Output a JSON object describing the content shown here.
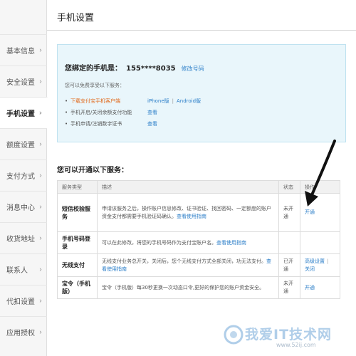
{
  "sidebar": {
    "items": [
      {
        "label": "基本信息",
        "active": false
      },
      {
        "label": "安全设置",
        "active": false
      },
      {
        "label": "手机设置",
        "active": true
      },
      {
        "label": "额度设置",
        "active": false
      },
      {
        "label": "支付方式",
        "active": false
      },
      {
        "label": "消息中心",
        "active": false
      },
      {
        "label": "收货地址",
        "active": false
      },
      {
        "label": "联系人",
        "active": false
      },
      {
        "label": "代扣设置",
        "active": false
      },
      {
        "label": "应用授权",
        "active": false
      }
    ],
    "chevron": "›"
  },
  "page": {
    "title": "手机设置"
  },
  "info": {
    "bound_label": "您绑定的手机是：",
    "phone": "155****8035",
    "modify_link": "修改号码",
    "free_intro": "您可以免费享受以下服务：",
    "services": [
      {
        "text": "下载支付宝手机客户端",
        "highlight": true,
        "links": [
          "iPhone版",
          "Android版"
        ]
      },
      {
        "text": "手机开启/关闭余额支付功能",
        "highlight": false,
        "links": [
          "查看"
        ]
      },
      {
        "text": "手机申请/注销数字证书",
        "highlight": false,
        "links": [
          "查看"
        ]
      }
    ]
  },
  "open_services": {
    "heading": "您可以开通以下服务：",
    "columns": [
      "服务类型",
      "描述",
      "状态",
      "操作"
    ],
    "rows": [
      {
        "name": "短信校验服务",
        "desc": "申请该服务之后，操作账户信息修改、证书验证、找回密码、一定额度的账户资金支付都需要手机验证码确认。",
        "desc_link": "查看使用指南",
        "status": "未开通",
        "ops": [
          "开通"
        ]
      },
      {
        "name": "手机号码登录",
        "desc": "可以在此修改，将您的手机号码作为支付宝账户名。",
        "desc_link": "查看使用指南",
        "status": "",
        "ops": []
      },
      {
        "name": "无线支付",
        "desc": "无线支付业务总开关，关闭后，您个无线支付方式全部关闭，功无法支付。",
        "desc_link": "查看使用指南",
        "status": "已开通",
        "ops": [
          "高级设置",
          "关闭"
        ]
      },
      {
        "name": "宝令（手机版）",
        "desc": "宝令（手机版）每30秒更换一次动态口令,更好的保护您的账户资金安全。",
        "desc_link": "",
        "status": "未开通",
        "ops": [
          "开通"
        ]
      }
    ]
  },
  "watermark": {
    "text": "我爱IT技术网",
    "url": "www.52ij.com"
  },
  "colors": {
    "accent": "#2b7ec8",
    "highlight": "#e1691c",
    "info_bg": "#e9f6fb"
  }
}
